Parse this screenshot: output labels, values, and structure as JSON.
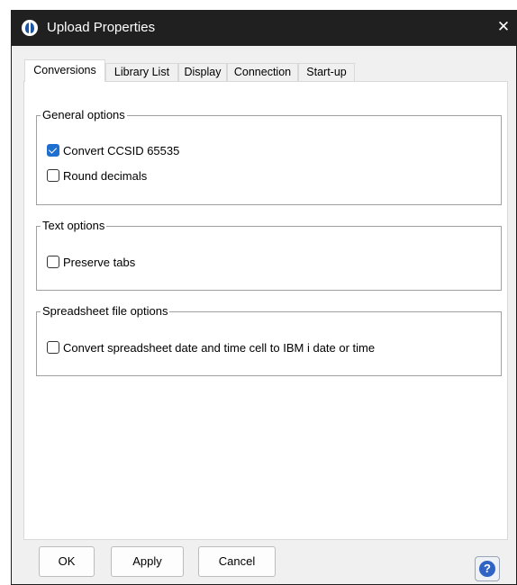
{
  "window": {
    "title": "Upload Properties",
    "close_glyph": "✕"
  },
  "tabs": [
    {
      "label": "Conversions",
      "active": true
    },
    {
      "label": "Library List",
      "active": false
    },
    {
      "label": "Display",
      "active": false
    },
    {
      "label": "Connection",
      "active": false
    },
    {
      "label": "Start-up",
      "active": false
    }
  ],
  "groups": {
    "general": {
      "title": "General options",
      "options": [
        {
          "label": "Convert CCSID 65535",
          "checked": true
        },
        {
          "label": "Round decimals",
          "checked": false
        }
      ]
    },
    "text": {
      "title": "Text options",
      "options": [
        {
          "label": "Preserve tabs",
          "checked": false
        }
      ]
    },
    "spreadsheet": {
      "title": "Spreadsheet file options",
      "options": [
        {
          "label": "Convert spreadsheet date and time cell to IBM i date or time",
          "checked": false
        }
      ]
    }
  },
  "buttons": {
    "ok": "OK",
    "apply": "Apply",
    "cancel": "Cancel",
    "help_glyph": "?"
  },
  "icons": {
    "app": "app-logo-icon",
    "close": "close-icon",
    "help": "help-icon",
    "check": "checkmark-icon"
  },
  "colors": {
    "titlebar": "#202020",
    "accent": "#1f6fd1",
    "help": "#2f63c4"
  }
}
